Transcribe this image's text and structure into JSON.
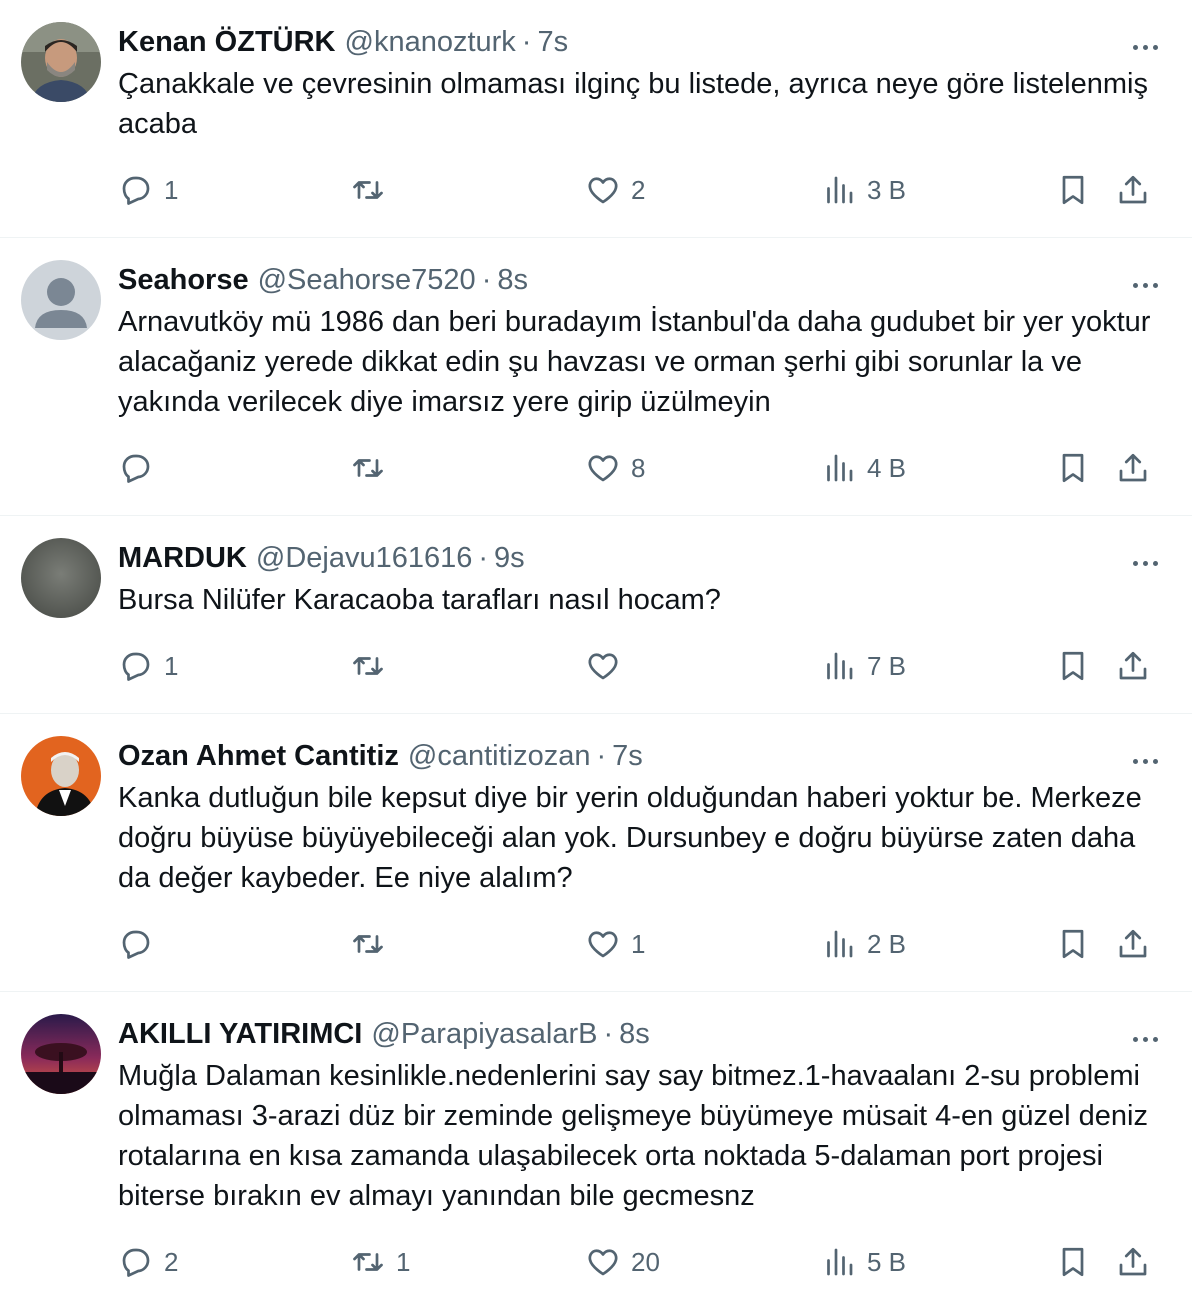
{
  "tweets": [
    {
      "name": "Kenan ÖZTÜRK",
      "handle": "@knanozturk",
      "time": "7s",
      "text": "Çanakkale ve çevresinin olmaması ilginç bu listede, ayrıca neye göre listelenmiş acaba",
      "replies": "1",
      "retweets": "",
      "likes": "2",
      "views": "3 B"
    },
    {
      "name": "Seahorse",
      "handle": "@Seahorse7520",
      "time": "8s",
      "text": "Arnavutköy mü 1986 dan beri buradayım İstanbul'da daha gudubet bir yer yoktur alacağaniz yerede dikkat edin şu havzası ve orman şerhi gibi sorunlar la ve yakında verilecek diye imarsız yere girip üzülmeyin",
      "replies": "",
      "retweets": "",
      "likes": "8",
      "views": "4 B"
    },
    {
      "name": "MARDUK",
      "handle": "@Dejavu161616",
      "time": "9s",
      "text": "Bursa Nilüfer Karacaoba tarafları nasıl hocam?",
      "replies": "1",
      "retweets": "",
      "likes": "",
      "views": "7 B"
    },
    {
      "name": "Ozan Ahmet Cantitiz",
      "handle": "@cantitizozan",
      "time": "7s",
      "text": "Kanka dutluğun bile kepsut diye bir yerin olduğundan haberi yoktur be. Merkeze doğru büyüse büyüyebileceği alan yok. Dursunbey e doğru büyürse zaten daha da değer kaybeder. Ee niye alalım?",
      "replies": "",
      "retweets": "",
      "likes": "1",
      "views": "2 B"
    },
    {
      "name": "AKILLI YATIRIMCI",
      "handle": "@ParapiyasalarB",
      "time": "8s",
      "text": "Muğla Dalaman kesinlikle.nedenlerini say say bitmez.1-havaalanı 2-su problemi olmaması 3-arazi düz bir zeminde gelişmeye büyümeye müsait 4-en güzel deniz rotalarına en kısa zamanda ulaşabilecek orta noktada 5-dalaman port  projesi biterse bırakın ev almayı yanından bile gecmesnz",
      "replies": "2",
      "retweets": "1",
      "likes": "20",
      "views": "5 B"
    }
  ],
  "dot_separator": "·",
  "colors": {
    "text": "#0f1419",
    "secondary": "#536471",
    "divider": "#eff3f4"
  },
  "icons": [
    "reply-icon",
    "retweet-icon",
    "like-icon",
    "views-icon",
    "bookmark-icon",
    "share-icon",
    "more-icon"
  ]
}
